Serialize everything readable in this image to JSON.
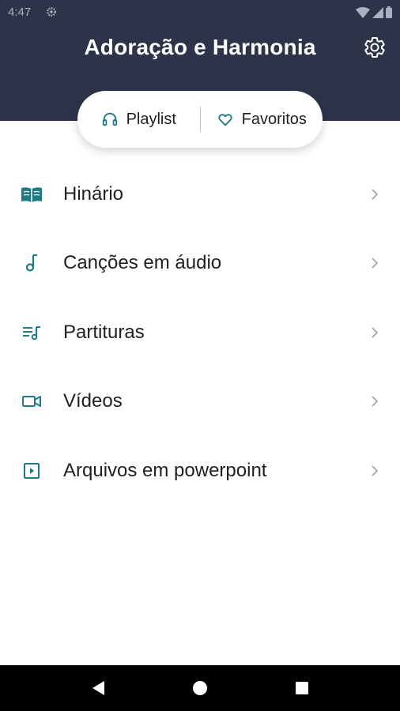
{
  "status_bar": {
    "time": "4:47"
  },
  "header": {
    "title": "Adoração e Harmonia"
  },
  "tabs": {
    "playlist": "Playlist",
    "favorites": "Favoritos"
  },
  "menu": {
    "items": [
      {
        "label": "Hinário",
        "icon": "book-icon"
      },
      {
        "label": "Canções em áudio",
        "icon": "music-note-icon"
      },
      {
        "label": "Partituras",
        "icon": "music-queue-icon"
      },
      {
        "label": "Vídeos",
        "icon": "video-camera-icon"
      },
      {
        "label": "Arquivos em powerpoint",
        "icon": "slideshow-icon"
      }
    ]
  },
  "colors": {
    "header_bg": "#2d3349",
    "accent": "#1f7a86",
    "nav_bg": "#000000"
  }
}
